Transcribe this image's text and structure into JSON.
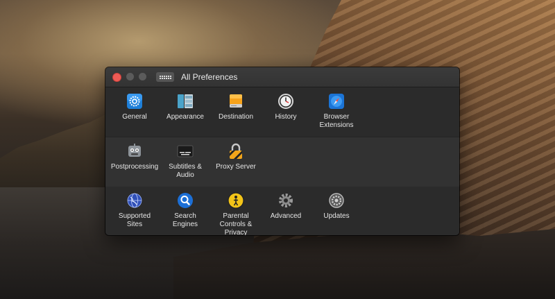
{
  "window": {
    "title": "All Preferences"
  },
  "rows": [
    {
      "items": [
        {
          "label": "General",
          "icon": "general-gear-icon"
        },
        {
          "label": "Appearance",
          "icon": "appearance-icon"
        },
        {
          "label": "Destination",
          "icon": "drive-icon"
        },
        {
          "label": "History",
          "icon": "clock-icon"
        },
        {
          "label": "Browser\nExtensions",
          "icon": "compass-icon"
        }
      ]
    },
    {
      "items": [
        {
          "label": "Postprocessing",
          "icon": "robot-icon"
        },
        {
          "label": "Subtitles &\nAudio",
          "icon": "subtitles-icon"
        },
        {
          "label": "Proxy Server",
          "icon": "lock-icon"
        }
      ]
    },
    {
      "items": [
        {
          "label": "Supported\nSites",
          "icon": "globe-icon"
        },
        {
          "label": "Search\nEngines",
          "icon": "magnifier-icon"
        },
        {
          "label": "Parental\nControls &\nPrivacy",
          "icon": "parental-icon"
        },
        {
          "label": "Advanced",
          "icon": "cog-icon"
        },
        {
          "label": "Updates",
          "icon": "updates-icon"
        }
      ]
    }
  ]
}
